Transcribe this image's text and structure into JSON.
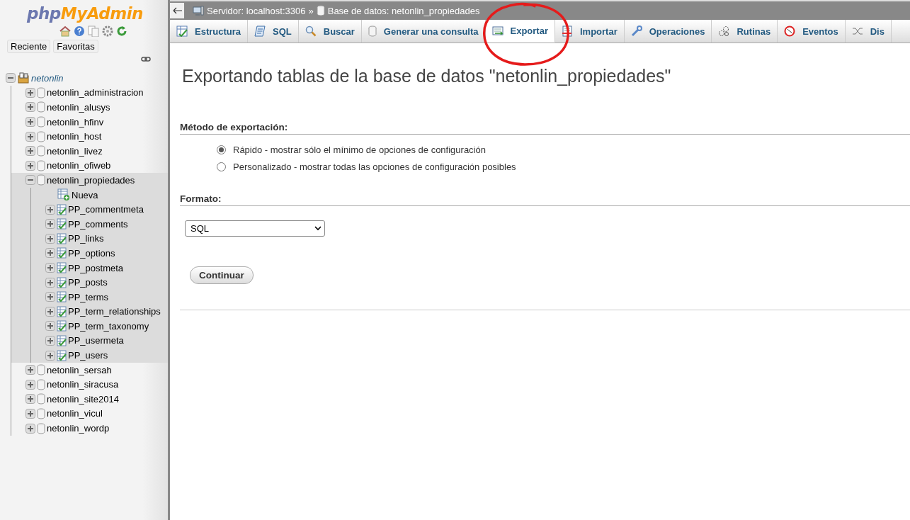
{
  "sidebar": {
    "logo": {
      "part_1": "php",
      "part_2": "MyAdmin"
    },
    "buttons": [
      "Reciente",
      "Favoritas"
    ],
    "tree": [
      {
        "label": "netonlin",
        "kind": "server",
        "expanded": true,
        "children": [
          {
            "label": "netonlin_administracion",
            "kind": "database",
            "expanded": false
          },
          {
            "label": "netonlin_alusys",
            "kind": "database",
            "expanded": false
          },
          {
            "label": "netonlin_hfinv",
            "kind": "database",
            "expanded": false
          },
          {
            "label": "netonlin_host",
            "kind": "database",
            "expanded": false
          },
          {
            "label": "netonlin_livez",
            "kind": "database",
            "expanded": false
          },
          {
            "label": "netonlin_ofiweb",
            "kind": "database",
            "expanded": false
          },
          {
            "label": "netonlin_propiedades",
            "kind": "database",
            "expanded": true,
            "children": [
              {
                "label": "Nueva",
                "kind": "new"
              },
              {
                "label": "PP_commentmeta",
                "kind": "table",
                "expanded": false
              },
              {
                "label": "PP_comments",
                "kind": "table",
                "expanded": false
              },
              {
                "label": "PP_links",
                "kind": "table",
                "expanded": false
              },
              {
                "label": "PP_options",
                "kind": "table",
                "expanded": false
              },
              {
                "label": "PP_postmeta",
                "kind": "table",
                "expanded": false
              },
              {
                "label": "PP_posts",
                "kind": "table",
                "expanded": false
              },
              {
                "label": "PP_terms",
                "kind": "table",
                "expanded": false
              },
              {
                "label": "PP_term_relationships",
                "kind": "table",
                "expanded": false
              },
              {
                "label": "PP_term_taxonomy",
                "kind": "table",
                "expanded": false
              },
              {
                "label": "PP_usermeta",
                "kind": "table",
                "expanded": false
              },
              {
                "label": "PP_users",
                "kind": "table",
                "expanded": false
              }
            ]
          },
          {
            "label": "netonlin_sersah",
            "kind": "database",
            "expanded": false
          },
          {
            "label": "netonlin_siracusa",
            "kind": "database",
            "expanded": false
          },
          {
            "label": "netonlin_site2014",
            "kind": "database",
            "expanded": false
          },
          {
            "label": "netonlin_vicul",
            "kind": "database",
            "expanded": false
          },
          {
            "label": "netonlin_wordp",
            "kind": "database",
            "expanded": false
          }
        ]
      }
    ]
  },
  "breadcrumb": {
    "server": "Servidor: localhost:3306",
    "separator": "»",
    "database": "Base de datos: netonlin_propiedades"
  },
  "tabs": [
    {
      "label": "Estructura",
      "selected": false
    },
    {
      "label": "SQL",
      "selected": false
    },
    {
      "label": "Buscar",
      "selected": false
    },
    {
      "label": "Generar una consulta",
      "selected": false
    },
    {
      "label": "Exportar",
      "selected": true
    },
    {
      "label": "Importar",
      "selected": false
    },
    {
      "label": "Operaciones",
      "selected": false
    },
    {
      "label": "Rutinas",
      "selected": false
    },
    {
      "label": "Eventos",
      "selected": false
    },
    {
      "label": "Dis",
      "selected": false
    }
  ],
  "main": {
    "title": "Exportando tablas de la base de datos \"netonlin_propiedades\"",
    "method": {
      "heading": "Método de exportación:",
      "options": [
        {
          "label": "Rápido - mostrar sólo el mínimo de opciones de configuración",
          "selected": true
        },
        {
          "label": "Personalizado - mostrar todas las opciones de configuración posibles",
          "selected": false
        }
      ]
    },
    "format": {
      "heading": "Formato:",
      "value": "SQL"
    },
    "submit": "Continuar"
  }
}
